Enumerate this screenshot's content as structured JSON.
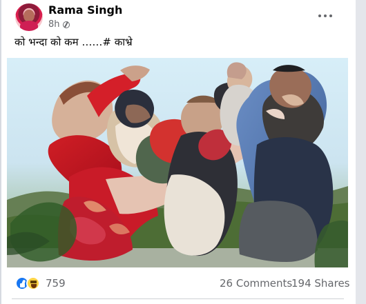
{
  "post": {
    "author_name": "Rama Singh",
    "time_ago": "8h",
    "privacy_icon": "globe-icon",
    "caption": "को भन्दा को कम ……# काभ्रे",
    "more_icon": "more-options-icon"
  },
  "photo": {
    "kind": "image"
  },
  "engagement": {
    "reaction_icons": [
      "like-icon",
      "haha-icon"
    ],
    "reaction_count": "759",
    "comments": "26 Comments",
    "shares": "194 Shares"
  },
  "colors": {
    "facebook_blue": "#1877f2",
    "haha_yellow": "#ffd345",
    "text_primary": "#050505",
    "text_secondary": "#65676b"
  }
}
